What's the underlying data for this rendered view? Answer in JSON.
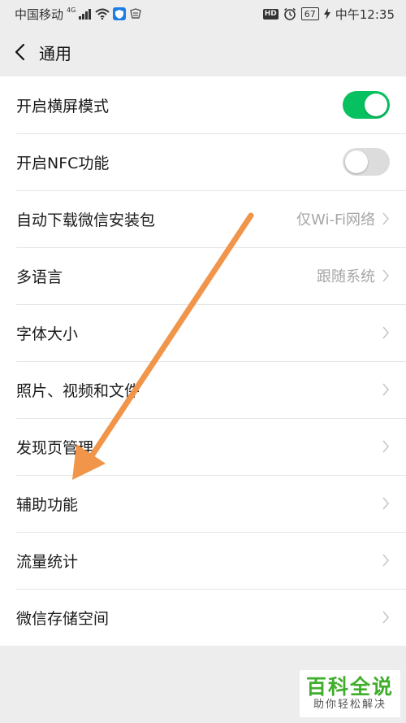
{
  "status_bar": {
    "carrier": "中国移动",
    "network": "4G",
    "battery": "67",
    "time": "中午12:35",
    "hd_label": "HD"
  },
  "header": {
    "title": "通用"
  },
  "settings": {
    "items": [
      {
        "label": "开启横屏模式",
        "toggle": "on"
      },
      {
        "label": "开启NFC功能",
        "toggle": "off"
      },
      {
        "label": "自动下载微信安装包",
        "value": "仅Wi-Fi网络"
      },
      {
        "label": "多语言",
        "value": "跟随系统"
      },
      {
        "label": "字体大小"
      },
      {
        "label": "照片、视频和文件"
      },
      {
        "label": "发现页管理"
      },
      {
        "label": "辅助功能"
      },
      {
        "label": "流量统计"
      },
      {
        "label": "微信存储空间"
      }
    ]
  },
  "colors": {
    "toggle_on": "#07c160",
    "toggle_off": "#dcdcdc",
    "arrow": "#f0954a",
    "background": "#ededed"
  },
  "watermark": {
    "title": "百科全说",
    "subtitle": "助你轻松解决"
  }
}
